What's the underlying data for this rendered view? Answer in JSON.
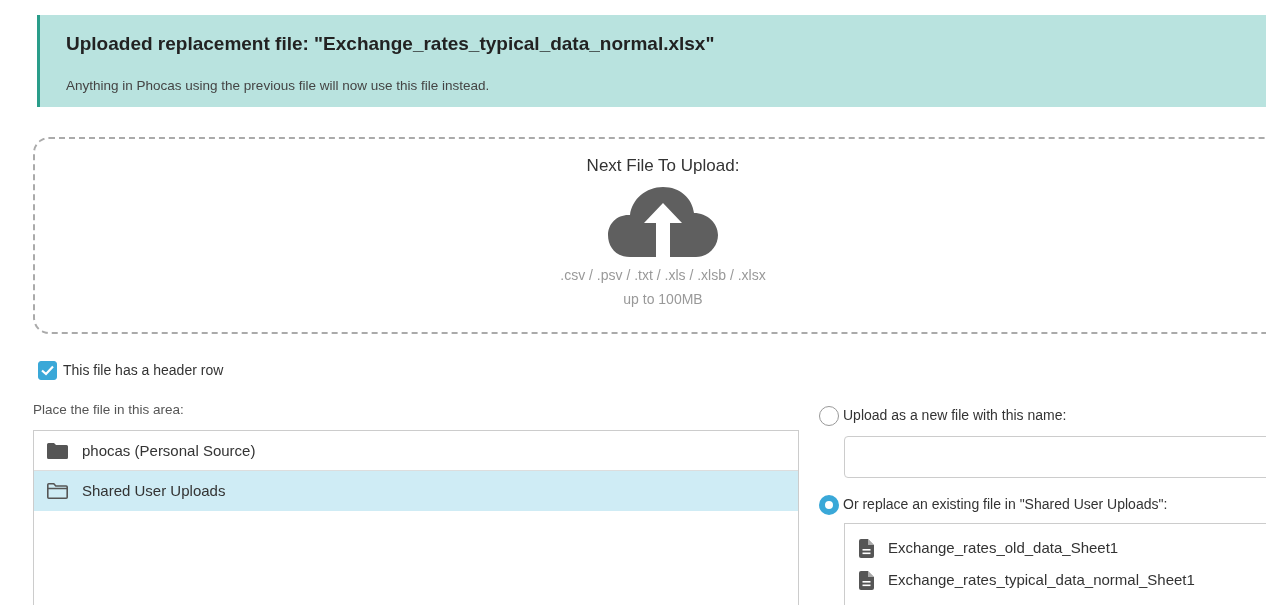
{
  "banner": {
    "title": "Uploaded replacement file: \"Exchange_rates_typical_data_normal.xlsx\"",
    "message": "Anything in Phocas using the previous file will now use this file instead."
  },
  "dropzone": {
    "title": "Next File To Upload:",
    "formats": ".csv / .psv / .txt / .xls / .xlsb / .xlsx",
    "limit": "up to 100MB"
  },
  "header_row": {
    "label": "This file has a header row",
    "checked": true
  },
  "area": {
    "label": "Place the file in this area:",
    "folders": [
      {
        "name": "phocas (Personal Source)",
        "kind": "source",
        "selected": false
      },
      {
        "name": "Shared User Uploads",
        "kind": "folder",
        "selected": true
      }
    ]
  },
  "options": [
    {
      "label": "Upload as a new file with this name:",
      "kind": "name-field",
      "selected": false
    },
    {
      "label": "Or replace an existing file in \"Shared User Uploads\":",
      "kind": "file-list",
      "selected": true,
      "files": [
        "Exchange_rates_old_data_Sheet1",
        "Exchange_rates_typical_data_normal_Sheet1"
      ]
    }
  ]
}
